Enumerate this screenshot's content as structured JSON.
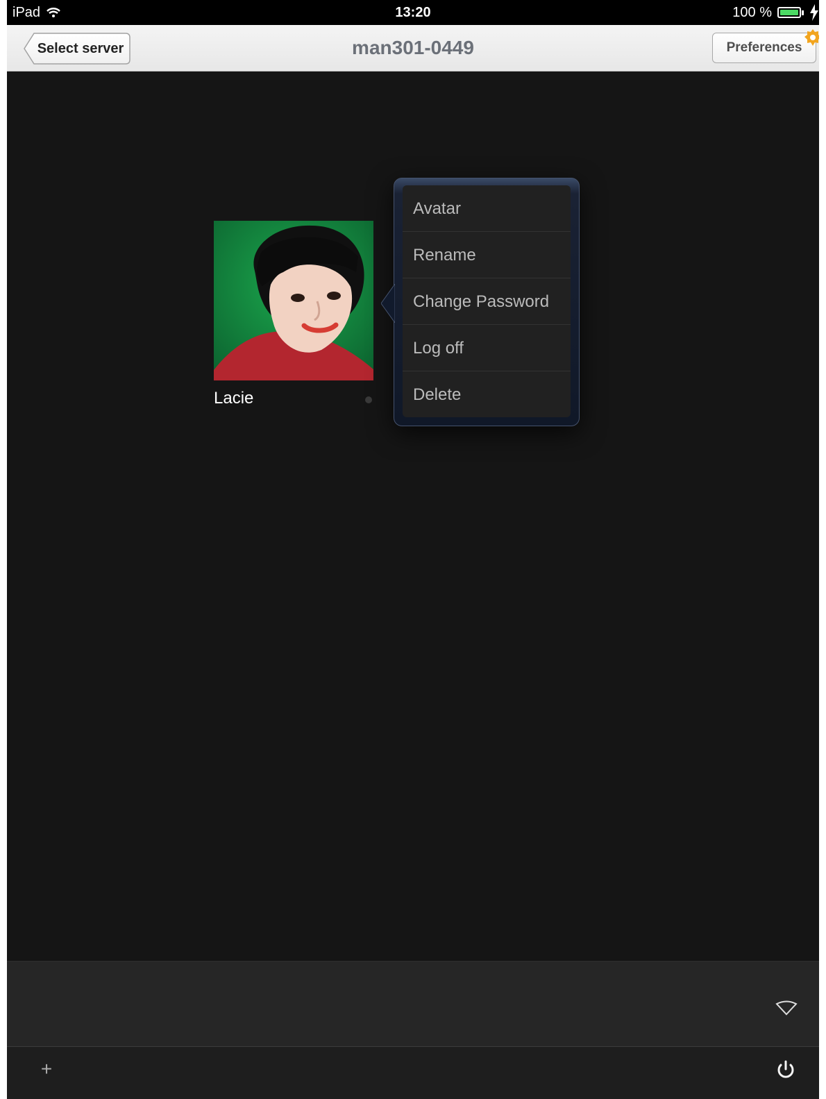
{
  "status_bar": {
    "carrier": "iPad",
    "time": "13:20",
    "battery_text": "100 %",
    "battery_percent": 100,
    "wifi_icon": "wifi-icon",
    "battery_icon": "battery-icon",
    "charging_icon": "lightning-bolt-icon"
  },
  "nav": {
    "back_label": "Select server",
    "title": "man301-0449",
    "preferences_label": "Preferences",
    "preferences_badge_icon": "gear-badge-icon"
  },
  "user": {
    "name": "Lacie",
    "avatar_icon": "user-avatar-photo",
    "status_icon": "status-dot"
  },
  "popover": {
    "items": [
      {
        "label": "Avatar"
      },
      {
        "label": "Rename"
      },
      {
        "label": "Change Password"
      },
      {
        "label": "Log off"
      },
      {
        "label": "Delete"
      }
    ]
  },
  "footer": {
    "add_icon": "+",
    "wifi_icon": "wifi-outline-icon",
    "power_icon": "power-icon"
  },
  "colors": {
    "background": "#151515",
    "nav_background": "#ececec",
    "nav_title": "#6b7078",
    "popover_border": "#45526c",
    "menu_background": "#212121",
    "menu_text": "#bbbbbb",
    "avatar_background": "#138a36",
    "badge": "#f2a51f"
  }
}
